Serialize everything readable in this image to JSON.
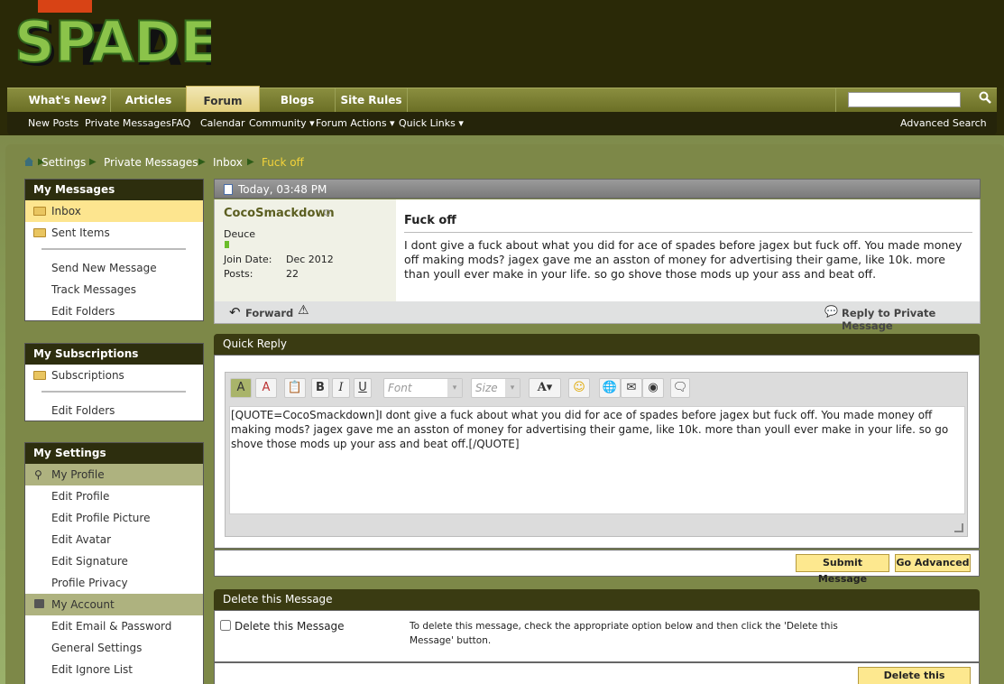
{
  "site": {
    "logo_text": "SPADES"
  },
  "nav": {
    "tabs": [
      "What's New?",
      "Articles",
      "Forum",
      "Blogs",
      "Site Rules"
    ],
    "search_placeholder": ""
  },
  "subnav": {
    "items": [
      "New Posts",
      "Private Messages",
      "FAQ",
      "Calendar",
      "Community ▾",
      "Forum Actions ▾",
      "Quick Links ▾"
    ],
    "advanced_search": "Advanced Search"
  },
  "breadcrumb": {
    "items": [
      "Settings",
      "Private Messages",
      "Inbox"
    ],
    "current": "Fuck off"
  },
  "sidebar": {
    "my_messages": {
      "title": "My Messages",
      "inbox": "Inbox",
      "sent": "Sent Items",
      "send_new": "Send New Message",
      "track": "Track Messages",
      "edit_folders": "Edit Folders"
    },
    "my_subscriptions": {
      "title": "My Subscriptions",
      "subscriptions": "Subscriptions",
      "edit_folders": "Edit Folders"
    },
    "my_settings": {
      "title": "My Settings",
      "profile_group": "My Profile",
      "profile_items": [
        "Edit Profile",
        "Edit Profile Picture",
        "Edit Avatar",
        "Edit Signature",
        "Profile Privacy"
      ],
      "account_group": "My Account",
      "account_items": [
        "Edit Email & Password",
        "General Settings",
        "Edit Ignore List"
      ]
    }
  },
  "message": {
    "date": "Today, 03:48 PM",
    "username": "CocoSmackdown",
    "rank": "Deuce",
    "join_label": "Join Date:",
    "join_value": "Dec 2012",
    "posts_label": "Posts:",
    "posts_value": "22",
    "title": "Fuck off",
    "body": "I dont give a fuck about what you did for ace of spades before jagex but fuck off. You made money off making mods? jagex gave me an asston of money for advertising their game, like 10k. more than youll ever make in your life. so go shove those mods up your ass and beat off.",
    "forward": "Forward",
    "reply": "Reply to Private Message"
  },
  "quick_reply": {
    "title": "Quick Reply",
    "font_placeholder": "Font",
    "size_placeholder": "Size",
    "text": "[QUOTE=CocoSmackdown]I dont give a fuck about what you did for ace of spades before jagex but fuck off. You made money off making mods? jagex gave me an asston of money for advertising their game, like 10k. more than youll ever make in your life. so go shove those mods up your ass and beat off.[/QUOTE]",
    "submit": "Submit Message",
    "advanced": "Go Advanced"
  },
  "delete": {
    "title": "Delete this Message",
    "checkbox_label": "Delete this Message",
    "instructions": "To delete this message, check the appropriate option below and then click the 'Delete this Message' button.",
    "button": "Delete this Message"
  },
  "colors": {
    "accent": "#fde88f",
    "bar": "#3a3b12",
    "link": "#5b5e20",
    "breadcrumb_current": "#f4d33a"
  }
}
